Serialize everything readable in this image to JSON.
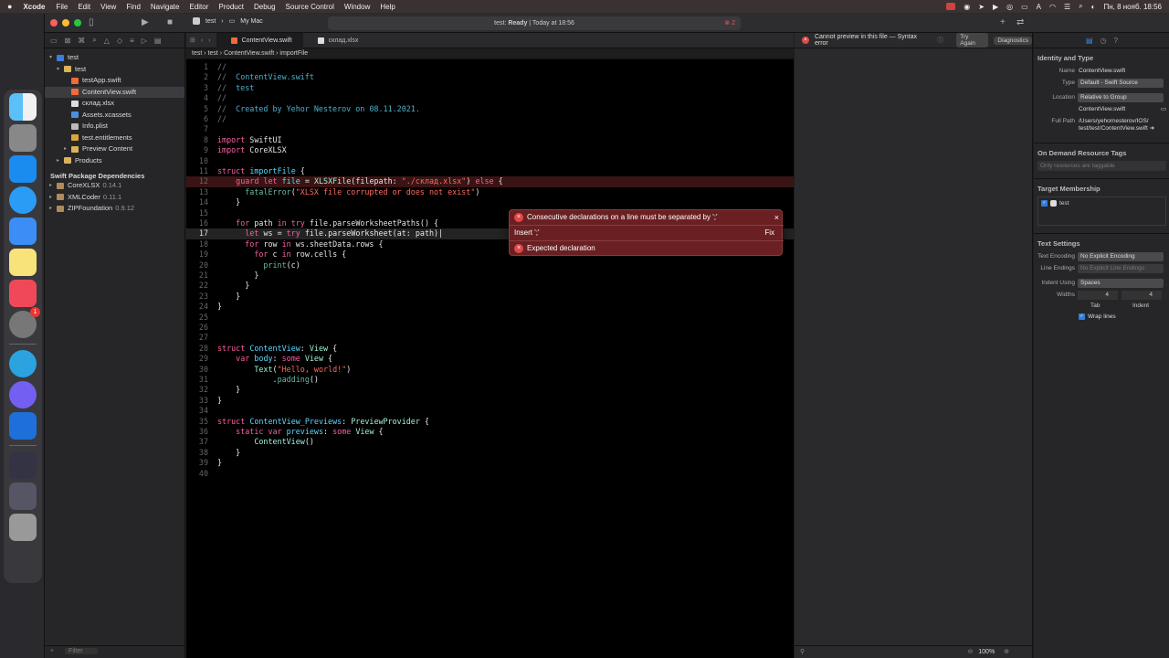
{
  "menubar": {
    "app": "Xcode",
    "items": [
      "File",
      "Edit",
      "View",
      "Find",
      "Navigate",
      "Editor",
      "Product",
      "Debug",
      "Source Control",
      "Window",
      "Help"
    ],
    "clock": "Пн, 8 нояб.  18:56"
  },
  "toolbar": {
    "scheme": "test",
    "destination": "My Mac",
    "status_prefix": "test: ",
    "status_state": "Ready",
    "status_time": " | Today at 18:56",
    "error_count": "2"
  },
  "dock": {
    "settings_badge": "1"
  },
  "navigator": {
    "project": "test",
    "group": "test",
    "files": [
      "testApp.swift",
      "ContentView.swift",
      "склад.xlsx",
      "Assets.xcassets",
      "Info.plist",
      "test.entitlements",
      "Preview Content"
    ],
    "products": "Products",
    "packages_title": "Swift Package Dependencies",
    "packages": [
      {
        "name": "CoreXLSX",
        "version": "0.14.1"
      },
      {
        "name": "XMLCoder",
        "version": "0.11.1"
      },
      {
        "name": "ZIPFoundation",
        "version": "0.9.12"
      }
    ],
    "filter_placeholder": "Filter"
  },
  "editor": {
    "tabs": [
      "ContentView.swift",
      "склад.xlsx"
    ],
    "jumpbar": [
      "test",
      "test",
      "ContentView.swift",
      "importFile"
    ],
    "current_line": 17,
    "error_line": 12
  },
  "popup": {
    "msg1": "Consecutive declarations on a line must be separated by ';'",
    "insert": "Insert ';'",
    "fix": "Fix",
    "msg2": "Expected declaration"
  },
  "preview": {
    "error": "Cannot preview in this file — Syntax error",
    "try_again": "Try Again",
    "diagnostics": "Diagnostics",
    "zoom": "100%"
  },
  "inspector": {
    "identity_title": "Identity and Type",
    "name_label": "Name",
    "name_value": "ContentView.swift",
    "type_label": "Type",
    "type_value": "Default - Swift Source",
    "location_label": "Location",
    "location_value": "Relative to Group",
    "location_file": "ContentView.swift",
    "fullpath_label": "Full Path",
    "fullpath_value1": "/Users/yehornesterov/IOS/",
    "fullpath_value2": "test/test/ContentView.swift",
    "odr_title": "On Demand Resource Tags",
    "odr_placeholder": "Only resources are taggable",
    "target_title": "Target Membership",
    "target_item": "test",
    "text_title": "Text Settings",
    "encoding_label": "Text Encoding",
    "encoding_value": "No Explicit Encoding",
    "endings_label": "Line Endings",
    "endings_value": "No Explicit Line Endings",
    "indent_label": "Indent Using",
    "indent_value": "Spaces",
    "widths_label": "Widths",
    "tab_value": "4",
    "indent_width_value": "4",
    "tab_label": "Tab",
    "indent_col_label": "Indent",
    "wrap_label": "Wrap lines"
  }
}
